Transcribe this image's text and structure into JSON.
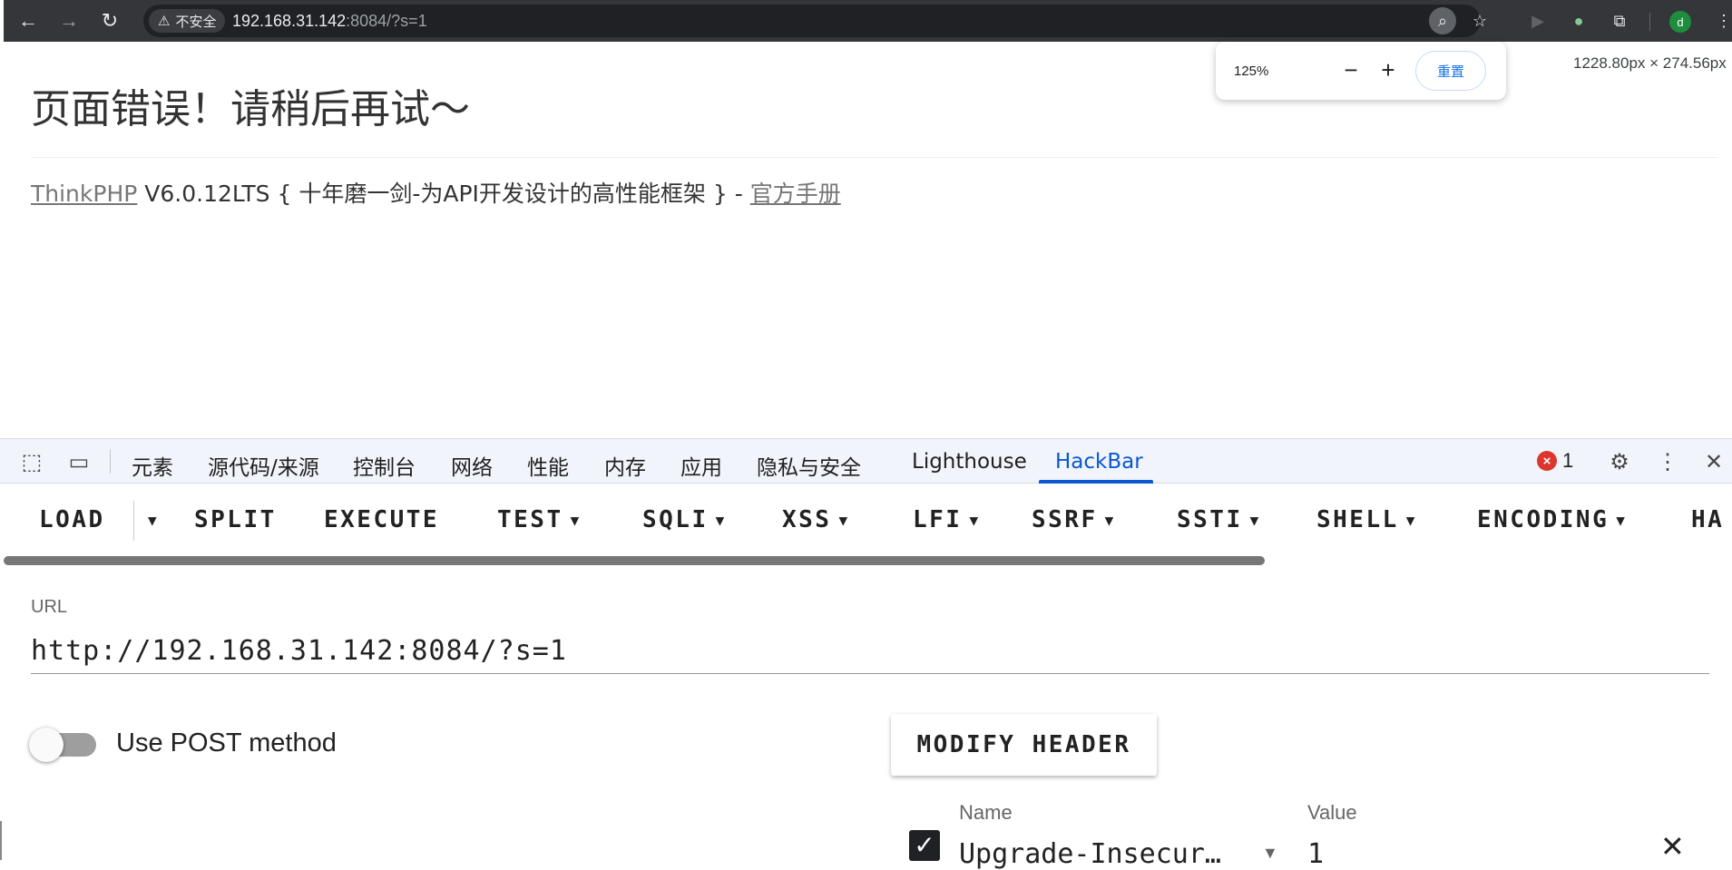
{
  "browser": {
    "security_label": "不安全",
    "url_host": "192.168.31.142",
    "url_rest": ":8084/?s=1",
    "avatar_letter": "d"
  },
  "zoom_popup": {
    "level": "125%",
    "minus": "−",
    "plus": "+",
    "reset": "重置"
  },
  "dimension_readout": "1228.80px × 274.56px",
  "page": {
    "heading": "页面错误！请稍后再试～",
    "framework_link": "ThinkPHP",
    "framework_text": " V6.0.12LTS { 十年磨一剑-为API开发设计的高性能框架 } - ",
    "manual_link": "官方手册"
  },
  "devtools": {
    "tabs": [
      "元素",
      "源代码/来源",
      "控制台",
      "网络",
      "性能",
      "内存",
      "应用",
      "隐私与安全",
      "Lighthouse",
      "HackBar"
    ],
    "active_tab": "HackBar",
    "error_count": "1"
  },
  "hackbar": {
    "menu": [
      "LOAD",
      "SPLIT",
      "EXECUTE",
      "TEST",
      "SQLI",
      "XSS",
      "LFI",
      "SSRF",
      "SSTI",
      "SHELL",
      "ENCODING",
      "HA"
    ],
    "url_label": "URL",
    "url_value": "http://192.168.31.142:8084/?s=1",
    "post_label": "Use POST method",
    "post_enabled": false,
    "modify_header": "MODIFY HEADER",
    "header_name_label": "Name",
    "header_value_label": "Value",
    "header_name": "Upgrade-Insecur…",
    "header_value": "1",
    "header_checked": true
  }
}
